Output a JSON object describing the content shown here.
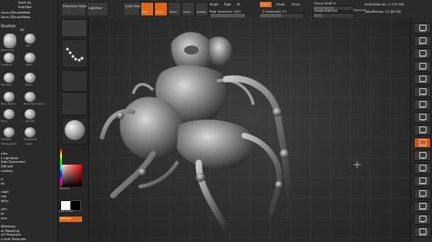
{
  "app": {
    "name": "ZBrush",
    "accent": "#e0661a",
    "left_menu_items": [
      "ries",
      "t Lightbox",
      "Into Documen",
      "ZBrush",
      "rushes",
      "",
      "e",
      "ht",
      "",
      "raph",
      "rial",
      "ikity",
      "",
      "ysh",
      "ie",
      "ace",
      "",
      "Masking",
      "al Masking",
      "ull Pressure",
      "s and Textures"
    ],
    "brush_labels": [
      "BasicCrush",
      "Clay",
      "ClayBuild",
      "Inflat",
      "Standard",
      "Move",
      "Move Elastic",
      "Move Topological",
      "Move",
      "Smooth",
      "PolishStr",
      "SnakeHook",
      "TrimDynamic",
      "Layer"
    ],
    "doc_tabs": [
      "Save As",
      "SubTitle",
      "Save ZBrushMesh",
      "Save ZBrushMesh"
    ],
    "brush_header": "Brushes",
    "brush_size_label": "50",
    "color_label": "Gradient",
    "switch_color_label": "SwitchColor",
    "alternate_label": "Alternate"
  },
  "toolbar": {
    "projection_master": "Projection Master",
    "lightbox": "LightBox",
    "quick_sketch": "Quick Sketch",
    "edit_label": "Edit",
    "draw_label": "Draw",
    "move_label": "Move",
    "scale_label": "Scale",
    "rotate_label": "Rotate",
    "mrgb_label": "Mrgb",
    "rgb_label": "Rgb",
    "m_label": "M",
    "rgb_intensity": "Rgb Intensity 100",
    "zadd": "Zadd",
    "zsub": "Zsub",
    "zcut": "Zcut",
    "z_intensity": "Z Intensity 51",
    "focal_shift": "Focal Shift 0",
    "draw_size": "Draw Size 64",
    "dynamic": "Dynamic",
    "active_points": "ActivePoints: 1.133 Mil",
    "total_points": "TotalPoints: 11.86 Mil"
  },
  "right_shelf": [
    "BPR",
    "SPix 3",
    "Scroll",
    "Zoom",
    "Actual",
    "AAHalf",
    "Persp",
    "Floor",
    "L.Sym",
    "Frame",
    "Move",
    "Scale",
    "Rotate",
    "PolyF",
    "Transp",
    "Solo",
    "Xpose"
  ]
}
